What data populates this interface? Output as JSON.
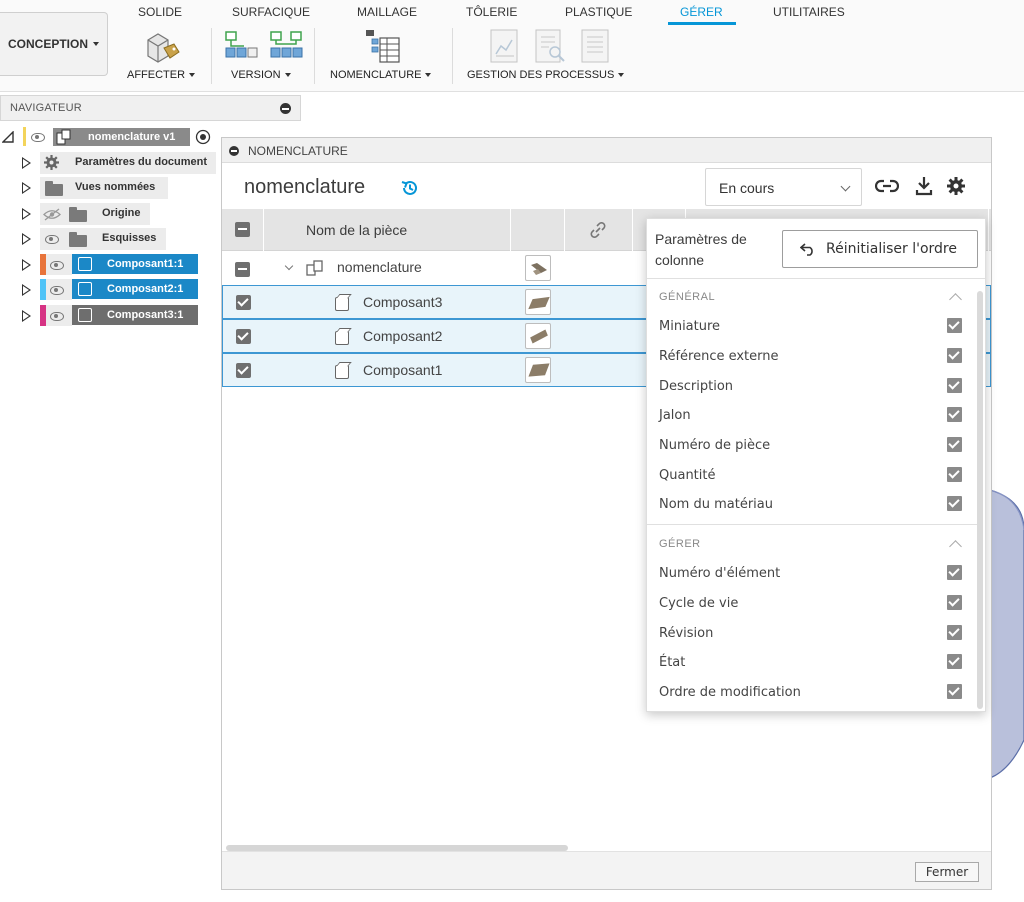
{
  "ribbon": {
    "workspace": "CONCEPTION",
    "tabs": [
      "SOLIDE",
      "SURFACIQUE",
      "MAILLAGE",
      "TÔLERIE",
      "PLASTIQUE",
      "GÉRER",
      "UTILITAIRES"
    ],
    "active_tab": "GÉRER",
    "groups": {
      "assign": "AFFECTER",
      "version": "VERSION",
      "bom": "NOMENCLATURE",
      "process": "GESTION DES PROCESSUS"
    }
  },
  "navigator": {
    "title": "NAVIGATEUR",
    "root": "nomenclature v1",
    "items": [
      "Paramètres du document",
      "Vues nommées",
      "Origine",
      "Esquisses"
    ],
    "components": [
      {
        "name": "Composant1:1",
        "color": "#e8743b"
      },
      {
        "name": "Composant2:1",
        "color": "#4fc3f7"
      },
      {
        "name": "Composant3:1",
        "color": "#d63384"
      }
    ]
  },
  "bom": {
    "panel_title": "NOMENCLATURE",
    "title": "nomenclature",
    "status": "En cours",
    "column_header": "Nom de la pièce",
    "root_row": "nomenclature",
    "rows": [
      "Composant3",
      "Composant2",
      "Composant1"
    ],
    "close": "Fermer"
  },
  "column_settings": {
    "title": "Paramètres de colonne",
    "reset": "Réinitialiser l'ordre",
    "general_label": "GÉNÉRAL",
    "general": [
      "Miniature",
      "Référence externe",
      "Description",
      "Jalon",
      "Numéro de pièce",
      "Quantité",
      "Nom du matériau"
    ],
    "manage_label": "GÉRER",
    "manage": [
      "Numéro d'élément",
      "Cycle de vie",
      "Révision",
      "État",
      "Ordre de modification"
    ]
  },
  "colors": {
    "accent": "#0696d7",
    "selected_row": "#e8f4fa",
    "component_chip": "#1b88c7"
  }
}
